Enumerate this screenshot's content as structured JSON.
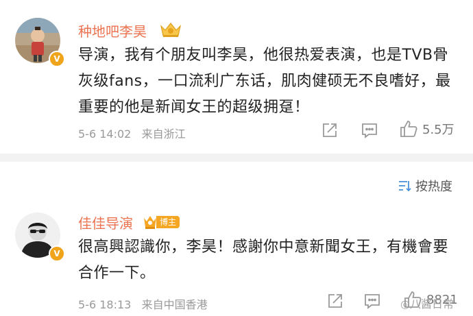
{
  "comments": [
    {
      "username": "种地吧李昊",
      "text": "导演，我有个朋友叫李昊，他很热爱表演，也是TVB骨灰级fans，一口流利广东话，肌肉健硕无不良嗜好，最重要的他是新闻女王的超级拥趸！",
      "timestamp": "5-6 14:02",
      "location": "来自浙江",
      "likes": "5.5万",
      "verified_badge": "V"
    },
    {
      "username": "佳佳导演",
      "badge_label": "博主",
      "text": "很高興認識你，李昊！感謝你中意新聞女王，有機會要合作一下。",
      "timestamp": "5-6 18:13",
      "location": "来自中国香港",
      "likes": "8821",
      "verified_badge": "V"
    }
  ],
  "sort": {
    "label": "按热度"
  },
  "watermark": "八酱日常",
  "colors": {
    "username": "#eb7350",
    "badge_orange": "#f5a623",
    "meta_gray": "#999999",
    "separator": "#f2f2f2"
  }
}
